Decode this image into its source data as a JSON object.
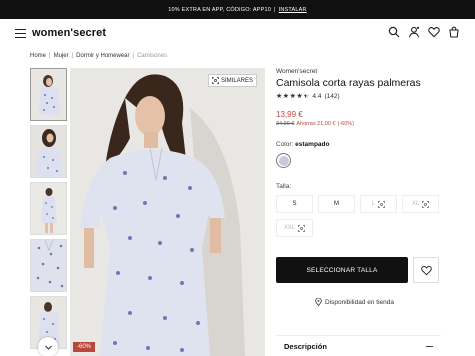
{
  "promo": {
    "text": "10% EXTRA EN APP, CÓDIGO: APP10",
    "separator": "|",
    "link": "INSTALAR"
  },
  "header": {
    "logo": "women'secret"
  },
  "breadcrumb": [
    {
      "label": "Home"
    },
    {
      "label": "Mujer"
    },
    {
      "label": "Dormir y Homewear"
    },
    {
      "label": "Camisones"
    }
  ],
  "breadcrumb_sep": "|",
  "gallery": {
    "similar_label": "SIMILARES",
    "discount_badge": "-60%"
  },
  "product": {
    "brand": "Women'secret",
    "title": "Camisola corta rayas palmeras",
    "rating_value": "4.4",
    "rating_count": "(142)",
    "stars_full": 4,
    "stars_half": 1,
    "price": "13,99 €",
    "old_price": "34,99 €",
    "savings": "Ahorras 21,00 €",
    "discount_pct": "(-60%)",
    "color_label": "Color:",
    "color_name": "estampado",
    "size_label": "Talla:",
    "sizes": [
      {
        "label": "S",
        "available": true
      },
      {
        "label": "M",
        "available": true
      },
      {
        "label": "L",
        "available": false
      },
      {
        "label": "XL",
        "available": false
      },
      {
        "label": "XXL",
        "available": false
      }
    ],
    "select_size": "SELECCIONAR TALLA",
    "store_availability": "Disponibilidad en tienda",
    "description_label": "Descripción"
  },
  "colors": {
    "accent": "#b9473c",
    "dark": "#111111",
    "swatch": "#c7cadc"
  }
}
